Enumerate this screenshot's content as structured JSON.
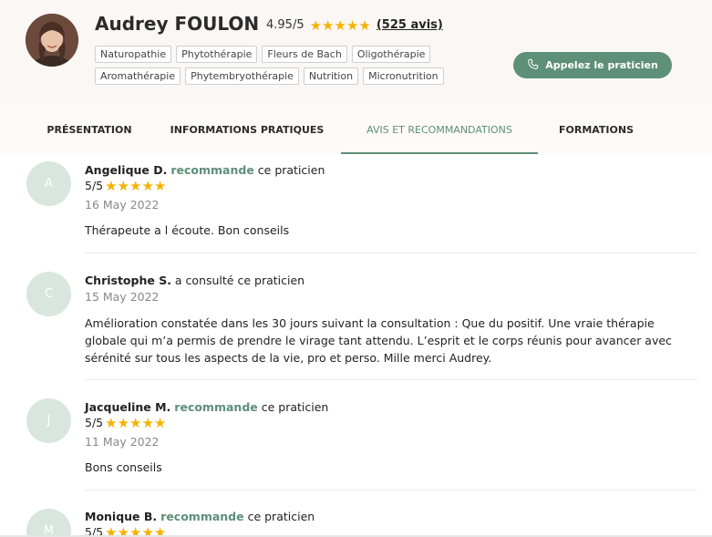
{
  "practitioner": {
    "name": "Audrey FOULON",
    "rating": "4.95/5",
    "stars": "★★★★★",
    "reviews_link": "(525 avis)",
    "tags_row1": [
      "Naturopathie",
      "Phytothérapie",
      "Fleurs de Bach",
      "Oligothérapie"
    ],
    "tags_row2": [
      "Aromathérapie",
      "Phytembryothérapie",
      "Nutrition",
      "Micronutrition"
    ],
    "call_button": "Appelez le praticien"
  },
  "tabs": [
    "PRÉSENTATION",
    "INFORMATIONS PRATIQUES",
    "AVIS ET RECOMMANDATIONS",
    "FORMATIONS"
  ],
  "active_tab": "AVIS ET RECOMMANDATIONS",
  "reviews": [
    {
      "initial": "A",
      "author": "Angelique D.",
      "action": "recommande",
      "suffix": " ce praticien",
      "score": "5/5",
      "stars": "★★★★★",
      "date": "16 May 2022",
      "comment": "Thérapeute a l écoute.  Bon conseils"
    },
    {
      "initial": "C",
      "author": "Christophe S.",
      "action": "",
      "suffix": " a consulté ce praticien",
      "score": "",
      "stars": "",
      "date": "15 May 2022",
      "comment": "Amélioration constatée dans les 30 jours suivant la consultation : Que du positif. Une vraie thérapie globale qui m’a permis de prendre le virage tant attendu. L’esprit et le corps réunis pour avancer avec sérénité sur tous les aspects de la vie, pro et perso. Mille merci Audrey."
    },
    {
      "initial": "J",
      "author": "Jacqueline M.",
      "action": "recommande",
      "suffix": " ce praticien",
      "score": "5/5",
      "stars": "★★★★★",
      "date": "11 May 2022",
      "comment": "Bons conseils"
    },
    {
      "initial": "M",
      "author": "Monique B.",
      "action": "recommande",
      "suffix": " ce praticien",
      "score": "5/5",
      "stars": "★★★★★",
      "date": "",
      "comment": ""
    }
  ],
  "colors": {
    "accent": "#5e8f78",
    "star": "#f5b301",
    "header_bg": "#fbf7f4",
    "avatar_circle": "#d8e6df"
  }
}
